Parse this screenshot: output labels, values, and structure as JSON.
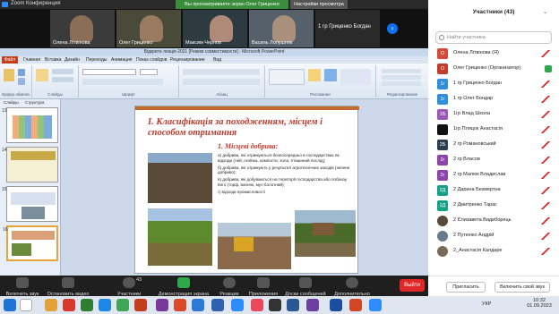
{
  "window": {
    "title": "Zoom Конференция"
  },
  "share_banner": "Вы просматриваете экран Олег Гриценко",
  "view_options": "Настройки просмотра",
  "video_tiles": [
    {
      "name": "Олена Літвінова"
    },
    {
      "name": "Олег Гриценко"
    },
    {
      "name": "Максим Чернов"
    },
    {
      "name": "Василь Лолушняк"
    },
    {
      "name": "1 гр Гриценко Богдан"
    }
  ],
  "ppt": {
    "title": "Відкрите лекція 2021 [Режим совместимости] - Microsoft PowerPoint",
    "file_tab": "Файл",
    "tabs": [
      "Главная",
      "Вставка",
      "Дизайн",
      "Переходы",
      "Анимация",
      "Показ слайдов",
      "Рецензирование",
      "Вид"
    ],
    "panel_tabs": [
      "Слайды",
      "Структура"
    ],
    "groups": [
      "Буфер обмена",
      "Слайды",
      "Шрифт",
      "Абзац",
      "Рисование",
      "Редактирование"
    ],
    "slide": {
      "heading": "І. Класифікація за походженням, місцем і способом отримання",
      "subheading": "1. Місцеві добрива:",
      "items": [
        "а) добрива, які отримуються безпосередньо в господарствах як відходи (гній, гноївка, компости, зола, пташиний послід);",
        "б) добрива, які отримують у результаті агротехнічних заходів (зелене добриво);",
        "в) добрива, які добуваються на території господарства або поблизу його (торф, вапняк, мул болотний);",
        "г) відходи промисловості"
      ]
    }
  },
  "toolbar": {
    "items": [
      {
        "label": "Включить звук"
      },
      {
        "label": "Остановить видео"
      },
      {
        "label": "Участники",
        "badge": "43"
      },
      {
        "label": "Демонстрация экрана"
      },
      {
        "label": "Реакции"
      },
      {
        "label": "Приложения"
      },
      {
        "label": "Доски сообщений"
      },
      {
        "label": "Дополнительно"
      }
    ],
    "leave": "Выйти"
  },
  "participants": {
    "header": "Участники (43)",
    "search_placeholder": "Найти участника",
    "list": [
      {
        "initials": "О",
        "color": "#d64a3c",
        "name": "Олена Літвінова (Я)"
      },
      {
        "initials": "О",
        "color": "#c23c2c",
        "name": "Олег Гриценко (Организатор)"
      },
      {
        "initials": "1г",
        "color": "#2f8fd8",
        "name": "1 гр Гриценко Богдан"
      },
      {
        "initials": "1г",
        "color": "#2f8fd8",
        "name": "1 гр Олег Бондар"
      },
      {
        "initials": "1Б",
        "color": "#9b59b6",
        "name": "1гр Влад Школа"
      },
      {
        "initials": "",
        "color": "#111111",
        "name": "1гр Пляцок Анастасія"
      },
      {
        "initials": "2Б",
        "color": "#2c3e50",
        "name": "2 гр Романовський"
      },
      {
        "initials": "2г",
        "color": "#8e44ad",
        "name": "2 гр Власов"
      },
      {
        "initials": "2г",
        "color": "#8e44ad",
        "name": "2 гр Малюк Владислав"
      },
      {
        "initials": "2Д",
        "color": "#16a085",
        "name": "2 Дарина Безмертна"
      },
      {
        "initials": "2Д",
        "color": "#16a085",
        "name": "2 Дмитренко Тарас"
      },
      {
        "initials": "",
        "color": "#5a4a3a",
        "name": "2 Єлизавета Видиборець"
      },
      {
        "initials": "",
        "color": "#6a7a8a",
        "name": "2 Путюнко Андрій"
      },
      {
        "initials": "",
        "color": "#7a6a5a",
        "name": "2_Анастасія Калдаре"
      }
    ],
    "invite": "Пригласить",
    "unmute_self": "Включить свой звук"
  },
  "taskbar": {
    "time": "10:32",
    "date": "01.09.2023",
    "lang": "УКР"
  }
}
